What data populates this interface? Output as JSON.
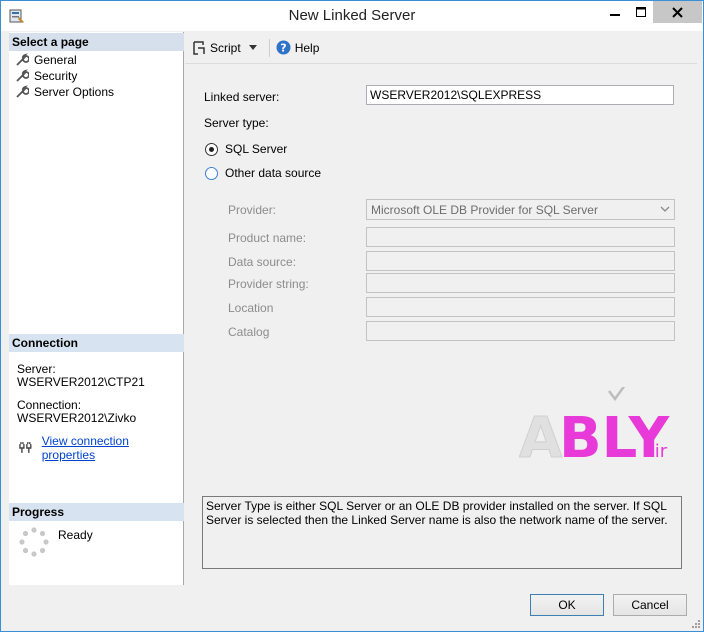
{
  "window": {
    "title": "New Linked Server"
  },
  "left": {
    "select_page_header": "Select a page",
    "pages": [
      {
        "label": "General"
      },
      {
        "label": "Security"
      },
      {
        "label": "Server Options"
      }
    ],
    "connection_header": "Connection",
    "server_label": "Server:",
    "server_value": "WSERVER2012\\CTP21",
    "connection_label": "Connection:",
    "connection_value": "WSERVER2012\\Zivko",
    "view_connection_link": "View connection properties",
    "progress_header": "Progress",
    "progress_status": "Ready"
  },
  "toolbar": {
    "script_label": "Script",
    "help_label": "Help"
  },
  "form": {
    "linked_server_label": "Linked server:",
    "linked_server_value": "WSERVER2012\\SQLEXPRESS",
    "server_type_label": "Server type:",
    "radio_sql_server": "SQL Server",
    "radio_other": "Other data source",
    "provider_label": "Provider:",
    "provider_value": "Microsoft OLE DB Provider for SQL Server",
    "product_name_label": "Product name:",
    "data_source_label": "Data source:",
    "provider_string_label": "Provider string:",
    "location_label": "Location",
    "catalog_label": "Catalog"
  },
  "logo": {
    "text": "ABLY",
    "suffix": ".ir"
  },
  "description": "Server Type is either SQL Server or an OLE DB provider installed on the server. If SQL Server is selected then the Linked Server name is also the network name of the server.",
  "buttons": {
    "ok": "OK",
    "cancel": "Cancel"
  },
  "colors": {
    "accent": "#3a8fd6",
    "link": "#0044cc",
    "header_bg": "#d7e3f0",
    "logo_pink": "#e83ad8"
  }
}
